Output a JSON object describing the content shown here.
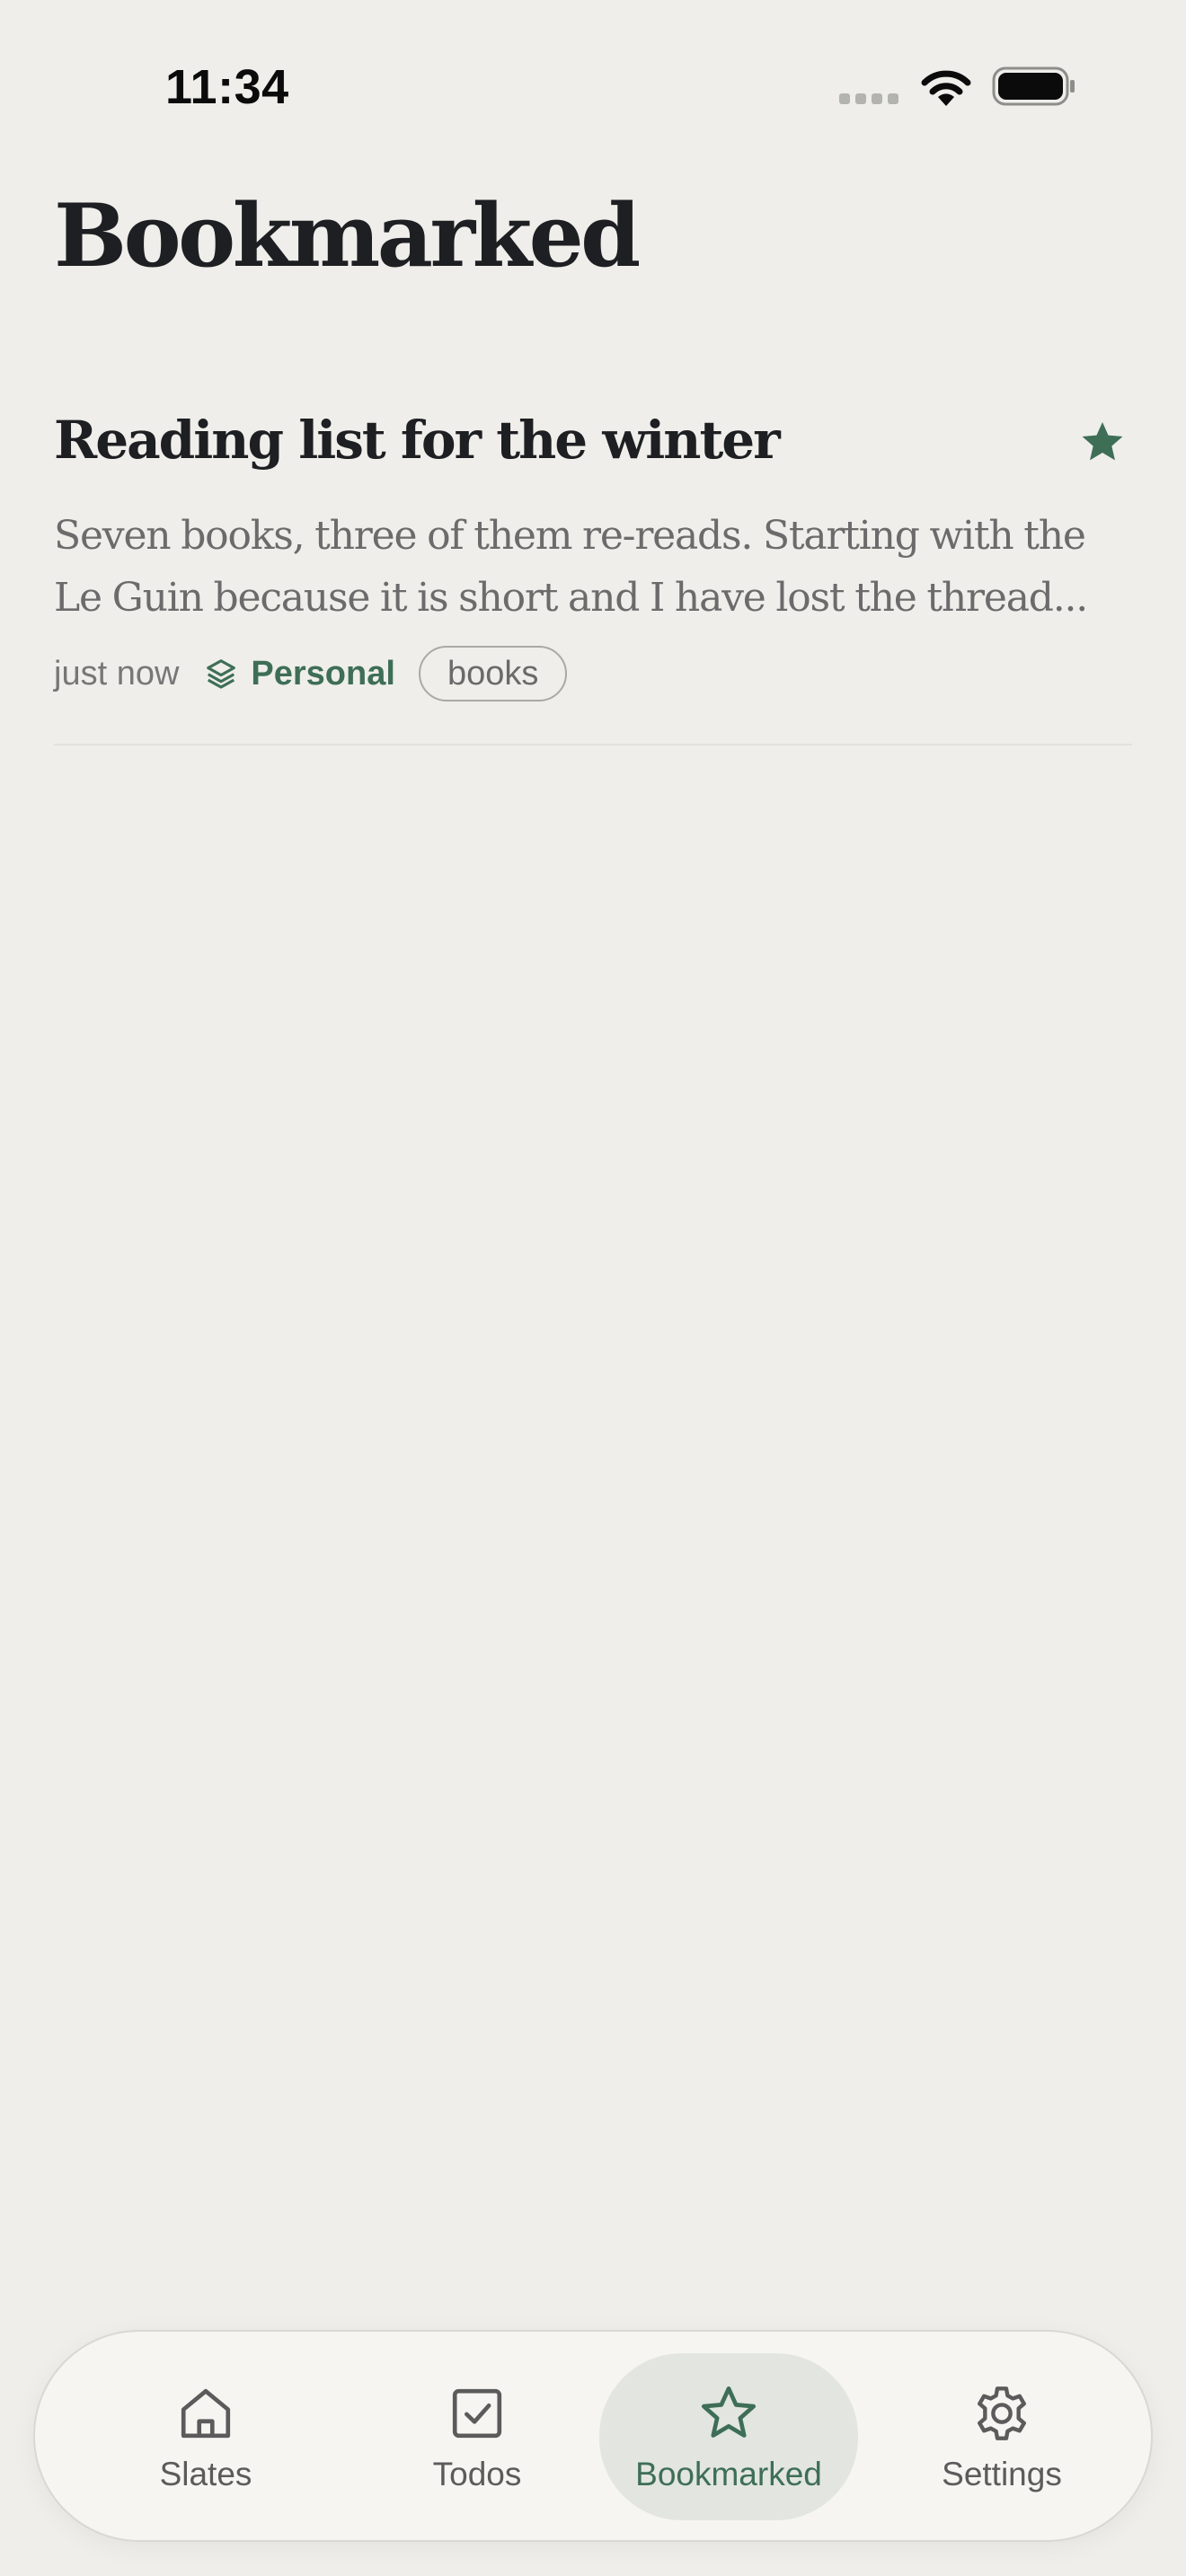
{
  "status_bar": {
    "time": "11:34"
  },
  "page": {
    "title": "Bookmarked"
  },
  "notes": [
    {
      "title": "Reading list for the winter",
      "excerpt_lines": [
        "Seven books, three of them re-reads. Starting with the",
        "Le Guin because it is short and I have lost the thread..."
      ],
      "timestamp": "just now",
      "folder": "Personal",
      "tag": "books",
      "bookmarked": true
    }
  ],
  "tab_bar": {
    "tabs": [
      {
        "label": "Slates",
        "icon": "home-icon"
      },
      {
        "label": "Todos",
        "icon": "checkbox-icon"
      },
      {
        "label": "Bookmarked",
        "icon": "star-icon",
        "active": true
      },
      {
        "label": "Settings",
        "icon": "gear-icon"
      }
    ]
  },
  "colors": {
    "background": "#efeeea",
    "accent": "#3e6e56",
    "text_primary": "#1d1f22",
    "text_secondary": "#6b6b6b",
    "tab_bar_background": "#f6f5f1",
    "active_tab_background": "#e2e5e0"
  }
}
